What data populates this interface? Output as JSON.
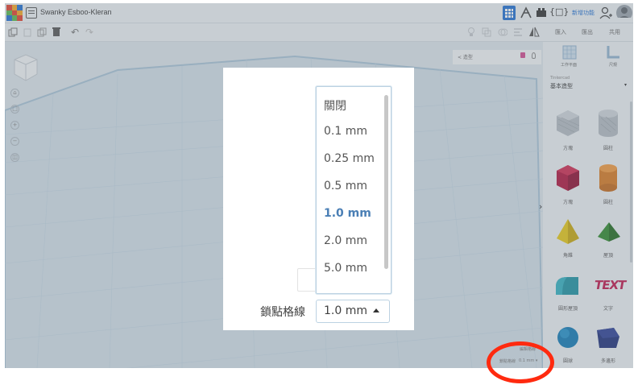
{
  "app": {
    "title": "Swanky Esboo-Kleran",
    "user_link": "新增功能"
  },
  "toolbar": {
    "undo": "↶",
    "redo": "↷",
    "actions": [
      "匯入",
      "匯出",
      "共用"
    ]
  },
  "inspector": {
    "shape_label": "< 造型"
  },
  "right_panel": {
    "workplane_label": "工作平面",
    "ruler_label": "尺規",
    "library_caption": "Tinkercad",
    "library_name": "基本造型",
    "shapes": [
      "方塊",
      "圓柱",
      "方塊",
      "圓柱",
      "角錐",
      "屋頂",
      "圓形屋頂",
      "文字",
      "圓球",
      "多邊形"
    ],
    "text_shape_word": "TEXT"
  },
  "grid": {
    "edit_grid_label": "編輯格線",
    "snap_label_small": "鎖點格線",
    "snap_value_small": "0.1 mm ▾"
  },
  "snap_dialog": {
    "label": "鎖點格線",
    "selected_value": "1.0 mm",
    "options": [
      "關閉",
      "0.1 mm",
      "0.25 mm",
      "0.5 mm",
      "1.0 mm",
      "2.0 mm",
      "5.0 mm"
    ],
    "selected_index": 4
  },
  "colors": {
    "highlight": "#ff2a0f",
    "selected_option": "#4a7fb5",
    "brand_blue": "#1f6fd1"
  }
}
